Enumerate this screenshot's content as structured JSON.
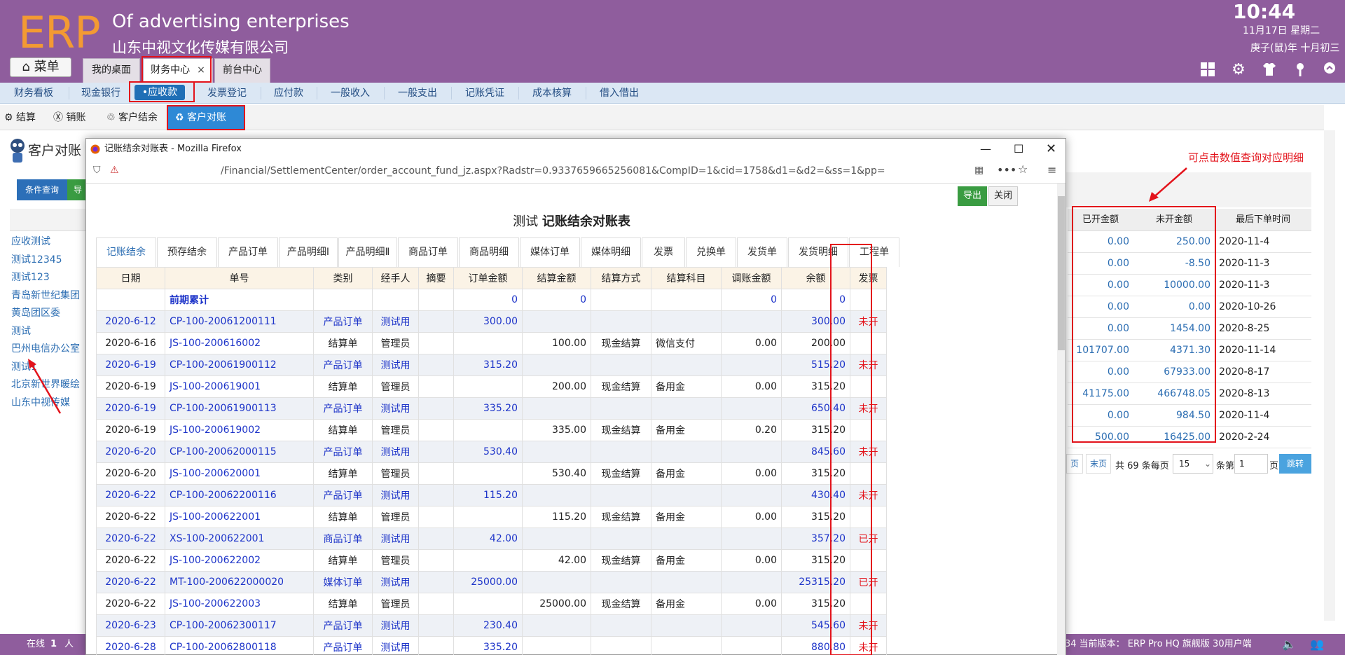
{
  "header": {
    "logo": "ERP",
    "slogan": "Of advertising enterprises",
    "company": "山东中视文化传媒有限公司",
    "time": "10:44",
    "date": "11月17日 星期二",
    "lunar": "庚子(鼠)年 十月初三",
    "menu_label": "菜单",
    "tabs": [
      {
        "label": "我的桌面"
      },
      {
        "label": "财务中心",
        "close": "×"
      },
      {
        "label": "前台中心"
      }
    ]
  },
  "menubar": {
    "items": [
      "财务看板",
      "现金银行",
      "•应收款",
      "发票登记",
      "应付款",
      "一般收入",
      "一般支出",
      "记账凭证",
      "成本核算",
      "借入借出"
    ]
  },
  "subbar": {
    "items": [
      "结算",
      "销账",
      "客户结余",
      "客户对账"
    ]
  },
  "page": {
    "title": "客户对账",
    "query_label": "条件查询",
    "export_label_short": "导",
    "customers": [
      "应收测试",
      "测试12345",
      "测试123",
      "青岛新世纪集团",
      "黄岛团区委",
      "测试",
      "巴州电信办公室",
      "测试1",
      "北京新世界暖绘",
      "山东中视传媒"
    ],
    "note": "可点击数值查询对应明细",
    "bg_headers": [
      "已开金额",
      "未开金额",
      "最后下单时间"
    ],
    "bg_rows": [
      [
        "0.00",
        "250.00",
        "2020-11-4"
      ],
      [
        "0.00",
        "-8.50",
        "2020-11-3"
      ],
      [
        "0.00",
        "10000.00",
        "2020-11-3"
      ],
      [
        "0.00",
        "0.00",
        "2020-10-26"
      ],
      [
        "0.00",
        "1454.00",
        "2020-8-25"
      ],
      [
        "101707.00",
        "4371.30",
        "2020-11-14"
      ],
      [
        "0.00",
        "67933.00",
        "2020-8-17"
      ],
      [
        "41175.00",
        "466748.05",
        "2020-8-13"
      ],
      [
        "0.00",
        "984.50",
        "2020-11-4"
      ],
      [
        "500.00",
        "16425.00",
        "2020-2-24"
      ]
    ],
    "pager": {
      "prev": "页",
      "last": "末页",
      "total": "共 69 条每页",
      "per_page": "15",
      "goto": "条第",
      "page": "1",
      "page_suffix": "页",
      "jump": "跳转"
    }
  },
  "statusbar": {
    "online": "在线",
    "online_count": "1",
    "online_unit": "人",
    "version": "34 当前版本：  ERP Pro HQ 旗舰版 30用户端"
  },
  "firefox": {
    "title": "记账结余对账表 - Mozilla Firefox",
    "url": "/Financial/SettlementCenter/order_account_fund_jz.aspx?Radstr=0.9337659665256081&CompID=1&cid=1758&d1=&d2=&ss=1&pp=",
    "export_label": "导出",
    "close_label": "关闭",
    "report_title_prefix": "测试",
    "report_title": "记账结余对账表",
    "tabs": [
      "记账结余",
      "预存结余",
      "产品订单",
      "产品明细Ⅰ",
      "产品明细Ⅱ",
      "商品订单",
      "商品明细",
      "媒体订单",
      "媒体明细",
      "发票",
      "兑换单",
      "发货单",
      "发货明细",
      "工程单"
    ],
    "columns": [
      "日期",
      "单号",
      "类别",
      "经手人",
      "摘要",
      "订单金额",
      "结算金额",
      "结算方式",
      "结算科目",
      "调账金额",
      "余额",
      "发票"
    ],
    "opening": {
      "label": "前期累计",
      "order": "0",
      "settle": "0",
      "adjust": "0",
      "balance": "0"
    },
    "rows": [
      {
        "date": "2020-6-12",
        "no": "CP-100-20061200111",
        "type": "产品订单",
        "handler": "测试用",
        "summary": "",
        "order": "300.00",
        "settle": "",
        "method": "",
        "subject": "",
        "adjust": "",
        "balance": "300.00",
        "invoice": "未开",
        "kind": "order"
      },
      {
        "date": "2020-6-16",
        "no": "JS-100-200616002",
        "type": "结算单",
        "handler": "管理员",
        "summary": "",
        "order": "",
        "settle": "100.00",
        "method": "现金结算",
        "subject": "微信支付",
        "adjust": "0.00",
        "balance": "200.00",
        "invoice": "",
        "kind": "settle"
      },
      {
        "date": "2020-6-19",
        "no": "CP-100-20061900112",
        "type": "产品订单",
        "handler": "测试用",
        "summary": "",
        "order": "315.20",
        "settle": "",
        "method": "",
        "subject": "",
        "adjust": "",
        "balance": "515.20",
        "invoice": "未开",
        "kind": "order"
      },
      {
        "date": "2020-6-19",
        "no": "JS-100-200619001",
        "type": "结算单",
        "handler": "管理员",
        "summary": "",
        "order": "",
        "settle": "200.00",
        "method": "现金结算",
        "subject": "备用金",
        "adjust": "0.00",
        "balance": "315.20",
        "invoice": "",
        "kind": "settle"
      },
      {
        "date": "2020-6-19",
        "no": "CP-100-20061900113",
        "type": "产品订单",
        "handler": "测试用",
        "summary": "",
        "order": "335.20",
        "settle": "",
        "method": "",
        "subject": "",
        "adjust": "",
        "balance": "650.40",
        "invoice": "未开",
        "kind": "order"
      },
      {
        "date": "2020-6-19",
        "no": "JS-100-200619002",
        "type": "结算单",
        "handler": "管理员",
        "summary": "",
        "order": "",
        "settle": "335.00",
        "method": "现金结算",
        "subject": "备用金",
        "adjust": "0.20",
        "balance": "315.20",
        "invoice": "",
        "kind": "settle"
      },
      {
        "date": "2020-6-20",
        "no": "CP-100-20062000115",
        "type": "产品订单",
        "handler": "测试用",
        "summary": "",
        "order": "530.40",
        "settle": "",
        "method": "",
        "subject": "",
        "adjust": "",
        "balance": "845.60",
        "invoice": "未开",
        "kind": "order"
      },
      {
        "date": "2020-6-20",
        "no": "JS-100-200620001",
        "type": "结算单",
        "handler": "管理员",
        "summary": "",
        "order": "",
        "settle": "530.40",
        "method": "现金结算",
        "subject": "备用金",
        "adjust": "0.00",
        "balance": "315.20",
        "invoice": "",
        "kind": "settle"
      },
      {
        "date": "2020-6-22",
        "no": "CP-100-20062200116",
        "type": "产品订单",
        "handler": "测试用",
        "summary": "",
        "order": "115.20",
        "settle": "",
        "method": "",
        "subject": "",
        "adjust": "",
        "balance": "430.40",
        "invoice": "未开",
        "kind": "order"
      },
      {
        "date": "2020-6-22",
        "no": "JS-100-200622001",
        "type": "结算单",
        "handler": "管理员",
        "summary": "",
        "order": "",
        "settle": "115.20",
        "method": "现金结算",
        "subject": "备用金",
        "adjust": "0.00",
        "balance": "315.20",
        "invoice": "",
        "kind": "settle"
      },
      {
        "date": "2020-6-22",
        "no": "XS-100-200622001",
        "type": "商品订单",
        "handler": "测试用",
        "summary": "",
        "order": "42.00",
        "settle": "",
        "method": "",
        "subject": "",
        "adjust": "",
        "balance": "357.20",
        "invoice": "已开",
        "kind": "order"
      },
      {
        "date": "2020-6-22",
        "no": "JS-100-200622002",
        "type": "结算单",
        "handler": "管理员",
        "summary": "",
        "order": "",
        "settle": "42.00",
        "method": "现金结算",
        "subject": "备用金",
        "adjust": "0.00",
        "balance": "315.20",
        "invoice": "",
        "kind": "settle"
      },
      {
        "date": "2020-6-22",
        "no": "MT-100-200622000020",
        "type": "媒体订单",
        "handler": "测试用",
        "summary": "",
        "order": "25000.00",
        "settle": "",
        "method": "",
        "subject": "",
        "adjust": "",
        "balance": "25315.20",
        "invoice": "已开",
        "kind": "order"
      },
      {
        "date": "2020-6-22",
        "no": "JS-100-200622003",
        "type": "结算单",
        "handler": "管理员",
        "summary": "",
        "order": "",
        "settle": "25000.00",
        "method": "现金结算",
        "subject": "备用金",
        "adjust": "0.00",
        "balance": "315.20",
        "invoice": "",
        "kind": "settle"
      },
      {
        "date": "2020-6-23",
        "no": "CP-100-20062300117",
        "type": "产品订单",
        "handler": "测试用",
        "summary": "",
        "order": "230.40",
        "settle": "",
        "method": "",
        "subject": "",
        "adjust": "",
        "balance": "545.60",
        "invoice": "未开",
        "kind": "order"
      },
      {
        "date": "2020-6-28",
        "no": "CP-100-20062800118",
        "type": "产品订单",
        "handler": "测试用",
        "summary": "",
        "order": "335.20",
        "settle": "",
        "method": "",
        "subject": "",
        "adjust": "",
        "balance": "880.80",
        "invoice": "未开",
        "kind": "order"
      }
    ]
  },
  "colors": {
    "header_bg": "#8f5d9d",
    "logo": "#f39a33",
    "highlight": "#e3131b",
    "link": "#1d34c9",
    "menu_active": "#1f6fb6"
  }
}
